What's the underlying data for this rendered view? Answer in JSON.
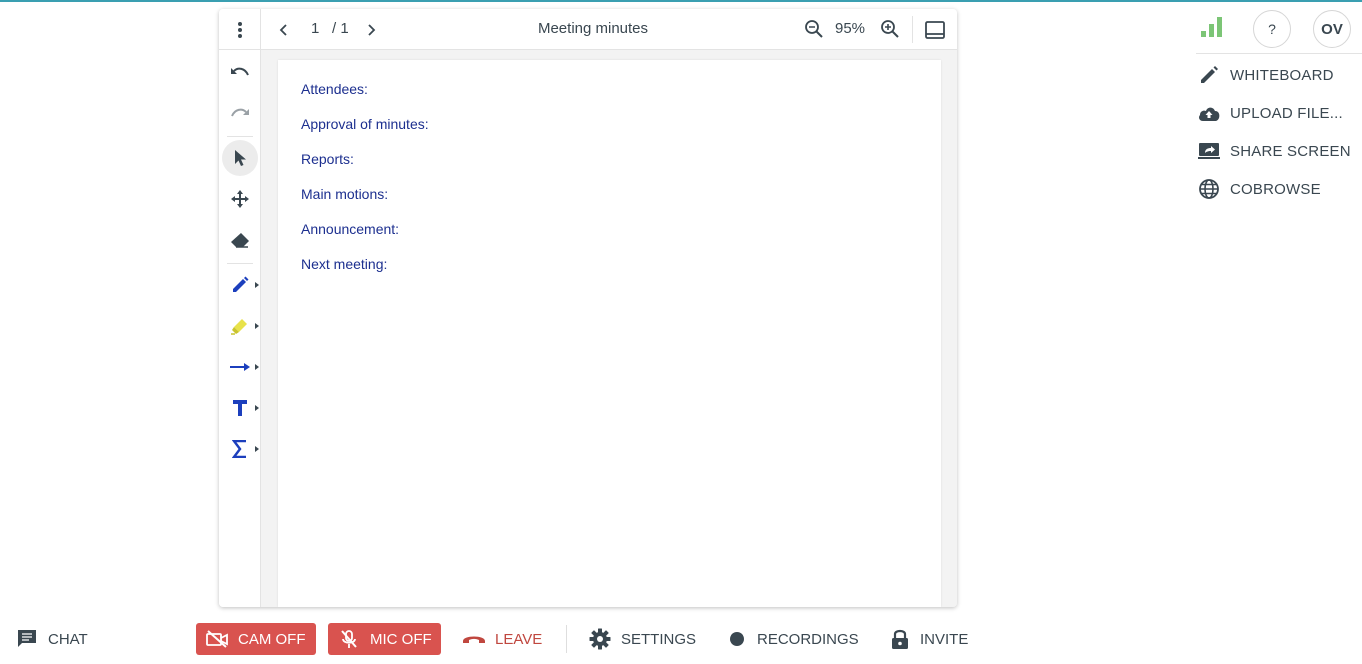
{
  "viewer": {
    "page_current": "1",
    "page_total": "/ 1",
    "title": "Meeting minutes",
    "zoom": "95%",
    "document_lines": [
      "Attendees:",
      "Approval of minutes:",
      "Reports:",
      "Main motions:",
      "Announcement:",
      "Next meeting:"
    ],
    "tools": [
      "undo-icon",
      "redo-icon",
      "select-cursor-icon",
      "pan-move-icon",
      "eraser-icon",
      "pen-icon",
      "highlighter-icon",
      "arrow-line-icon",
      "text-icon",
      "equation-sigma-icon"
    ]
  },
  "header": {
    "help_label": "?",
    "avatar_initials": "OV"
  },
  "share_menu": {
    "items": [
      {
        "label": "WHITEBOARD",
        "icon": "pencil-icon"
      },
      {
        "label": "UPLOAD FILE...",
        "icon": "cloud-upload-icon"
      },
      {
        "label": "SHARE SCREEN",
        "icon": "screen-share-icon"
      },
      {
        "label": "COBROWSE",
        "icon": "globe-icon"
      }
    ]
  },
  "bottom_bar": {
    "chat": "CHAT",
    "cam": "CAM OFF",
    "mic": "MIC OFF",
    "leave": "LEAVE",
    "settings": "SETTINGS",
    "recordings": "RECORDINGS",
    "invite": "INVITE"
  },
  "colors": {
    "accent_strip": "#3a9fb1",
    "danger": "#d9534f",
    "document_text": "#1c2f8f",
    "signal_green": "#7cc576",
    "ui_text": "#3a4750"
  }
}
